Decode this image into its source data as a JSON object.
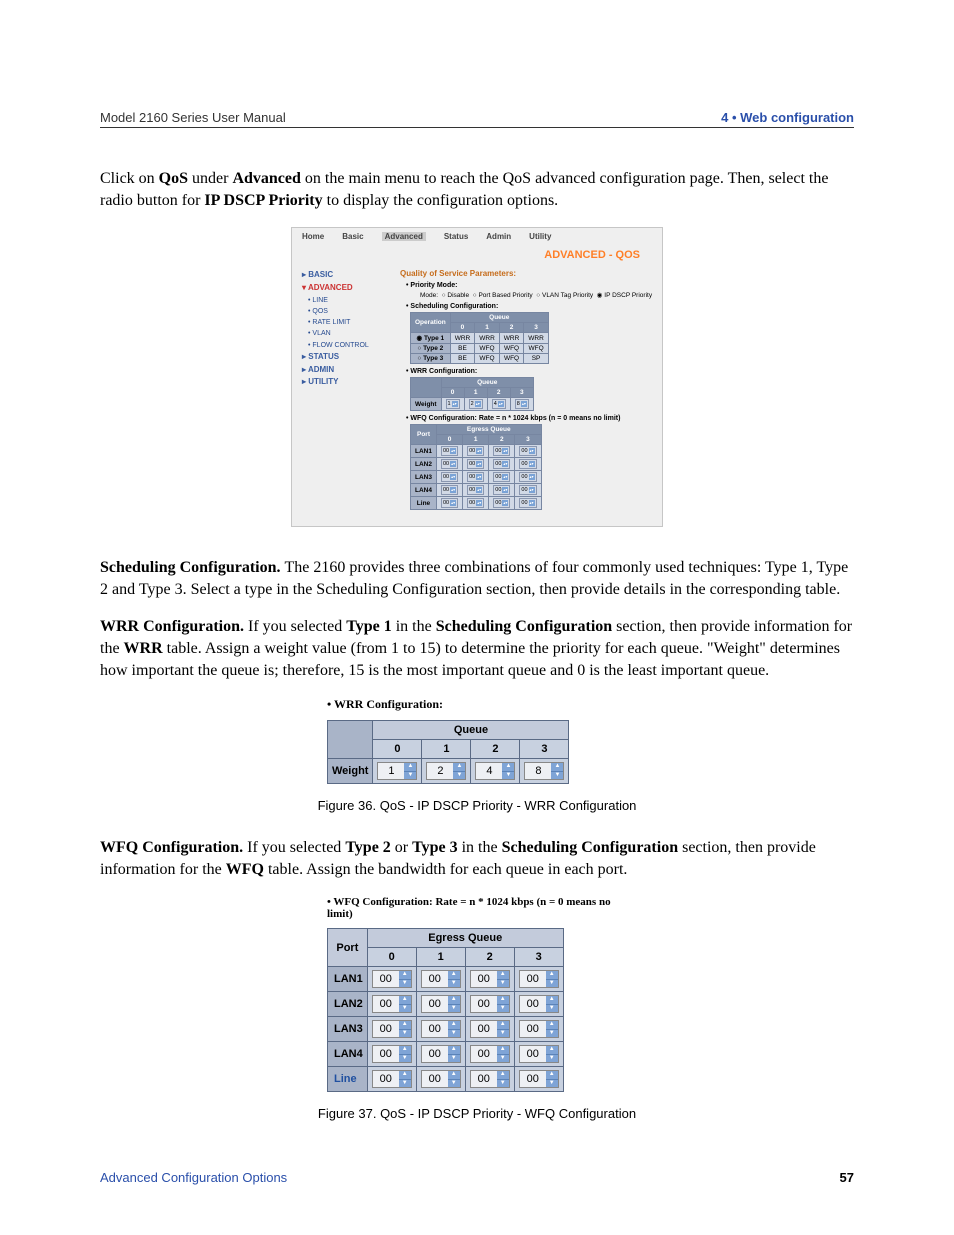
{
  "header": {
    "left": "Model 2160 Series User Manual",
    "right": "4 • Web configuration"
  },
  "p1": {
    "t1": "Click on ",
    "qos": "QoS",
    "t2": " under ",
    "adv": "Advanced",
    "t3": " on the main menu to reach the QoS advanced configuration page. Then, select the radio button for ",
    "ip": "IP DSCP Priority",
    "t4": " to display the configuration options."
  },
  "screenshot1": {
    "top": {
      "home": "Home",
      "basic": "Basic",
      "advanced": "Advanced",
      "status": "Status",
      "admin": "Admin",
      "utility": "Utility"
    },
    "title": "ADVANCED - QOS",
    "side": {
      "basic": "▸ BASIC",
      "advanced": "▾ ADVANCED",
      "line": "• LINE",
      "qos": "• QOS",
      "rate": "• RATE LIMIT",
      "vlan": "• VLAN",
      "flow": "• FLOW CONTROL",
      "status": "▸ STATUS",
      "admin": "▸ ADMIN",
      "utility": "▸ UTILITY"
    },
    "qsp": "Quality of Service Parameters:",
    "prio_mode": "• Priority Mode:",
    "mode_label": "Mode:",
    "mode_opts": {
      "disable": "Disable",
      "port": "Port Based Priority",
      "vlan": "VLAN Tag Priority",
      "ip": "IP DSCP Priority"
    },
    "sched_conf": "• Scheduling Configuration:",
    "sched_tbl": {
      "op": "Operation",
      "queue": "Queue",
      "cols": [
        "0",
        "1",
        "2",
        "3"
      ],
      "rows": [
        {
          "label": "Type 1",
          "cells": [
            "WRR",
            "WRR",
            "WRR",
            "WRR"
          ],
          "sel": true
        },
        {
          "label": "Type 2",
          "cells": [
            "BE",
            "WFQ",
            "WFQ",
            "WFQ"
          ],
          "sel": false
        },
        {
          "label": "Type 3",
          "cells": [
            "BE",
            "WFQ",
            "WFQ",
            "SP"
          ],
          "sel": false
        }
      ]
    },
    "wrr_conf": "• WRR Configuration:",
    "wrr_tbl": {
      "queue": "Queue",
      "cols": [
        "0",
        "1",
        "2",
        "3"
      ],
      "weight": "Weight",
      "vals": [
        "1",
        "2",
        "4",
        "8"
      ]
    },
    "wfq_conf": "• WFQ Configuration: Rate = n * 1024 kbps (n = 0 means no limit)",
    "wfq_tbl": {
      "port": "Port",
      "eq": "Egress Queue",
      "cols": [
        "0",
        "1",
        "2",
        "3"
      ],
      "rows": [
        "LAN1",
        "LAN2",
        "LAN3",
        "LAN4",
        "Line"
      ],
      "val": "00"
    }
  },
  "p2": {
    "sc": "Scheduling Configuration. ",
    "text": "The 2160 provides three combinations of four commonly used techniques: Type 1, Type 2 and Type 3.  Select a type in the Scheduling Configuration section, then provide details in the corresponding table."
  },
  "p3": {
    "wrr": "WRR Configuration. ",
    "t1": "If you selected ",
    "type1": "Type 1",
    "t2": " in the ",
    "sc": "Scheduling Configuration",
    "t3": " section, then provide information for the ",
    "wrr2": "WRR",
    "t4": " table.  Assign a weight value (from 1 to 15) to determine the priority for each queue. \"Weight\" determines how important the queue is; therefore, 15 is the most important queue and 0 is the least important queue."
  },
  "fig36": {
    "bullet": "•  WRR Configuration:",
    "queue": "Queue",
    "cols": [
      "0",
      "1",
      "2",
      "3"
    ],
    "weight": "Weight",
    "vals": [
      "1",
      "2",
      "4",
      "8"
    ],
    "caption": "Figure 36. QoS - IP DSCP Priority - WRR Configuration"
  },
  "p4": {
    "wfq": "WFQ Configuration. ",
    "t1": "If you selected ",
    "t2a": "Type 2",
    "or": " or ",
    "t2b": "Type 3",
    "t3": " in the ",
    "sc": "Scheduling Configuration",
    "t4": " section, then provide information for the ",
    "wfq2": "WFQ",
    "t5": " table.  Assign the bandwidth for each queue in each port."
  },
  "fig37": {
    "bullet": "•  WFQ Configuration: Rate = n * 1024 kbps (n = 0 means no limit)",
    "port": "Port",
    "equeue": "Egress Queue",
    "cols": [
      "0",
      "1",
      "2",
      "3"
    ],
    "rows": [
      "LAN1",
      "LAN2",
      "LAN3",
      "LAN4",
      "Line"
    ],
    "val": "00",
    "caption": "Figure 37. QoS - IP DSCP Priority - WFQ Configuration"
  },
  "footer": {
    "left": "Advanced Configuration Options",
    "right": "57"
  }
}
